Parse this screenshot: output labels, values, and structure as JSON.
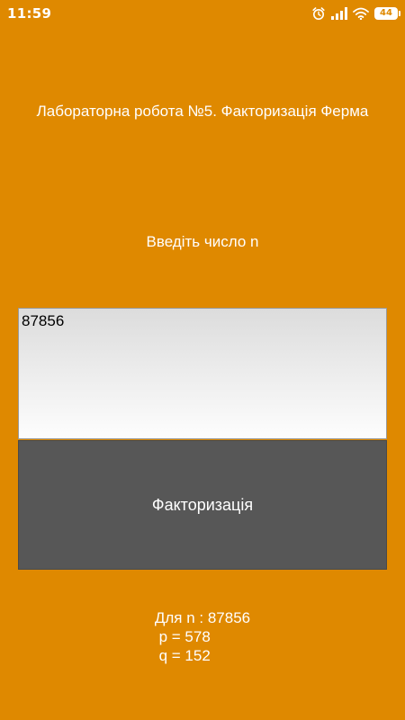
{
  "status_bar": {
    "time": "11:59",
    "battery_level": "44",
    "icons": [
      "alarm-clock-icon",
      "signal-icon",
      "wifi-icon",
      "battery-icon"
    ]
  },
  "app": {
    "title": "Лабораторна робота №5. Факторизація Ферма",
    "prompt": "Введіть число n",
    "input_value": "87856",
    "button_label": "Факторизація",
    "result_lines": [
      "Для n : 87856",
      " p = 578",
      " q = 152"
    ]
  },
  "colors": {
    "background": "#DF8900",
    "button": "#575757",
    "text": "#FFFFFF"
  }
}
